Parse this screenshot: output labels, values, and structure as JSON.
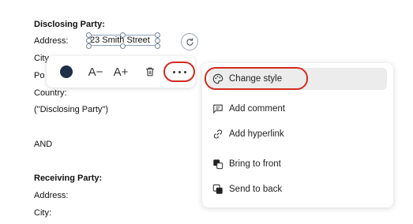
{
  "document": {
    "disclosing_heading": "Disclosing Party:",
    "address_label": "Address:",
    "city_label": "City",
    "postal_label": "Po",
    "country_label": "Country:",
    "disclosing_quote": "(\"Disclosing Party\")",
    "and_text": "AND",
    "receiving_heading": "Receiving Party:",
    "address_label_2": "Address:",
    "city_label_2": "City:"
  },
  "textbox": {
    "value": "23 Smith Street"
  },
  "toolbar": {
    "color": "#1f2f46",
    "decrease_font_label": "A−",
    "increase_font_label": "A+",
    "delete_icon": "trash-icon",
    "more_icon": "ellipsis-icon"
  },
  "menu": {
    "items": [
      {
        "label": "Change style",
        "icon": "palette-icon"
      },
      {
        "label": "Add comment",
        "icon": "comment-add-icon"
      },
      {
        "label": "Add hyperlink",
        "icon": "link-icon"
      },
      {
        "label": "Bring to front",
        "icon": "bring-front-icon"
      },
      {
        "label": "Send to back",
        "icon": "send-back-icon"
      }
    ]
  },
  "colors": {
    "highlight": "#d32b1f",
    "active_item_bg": "#ececec"
  }
}
